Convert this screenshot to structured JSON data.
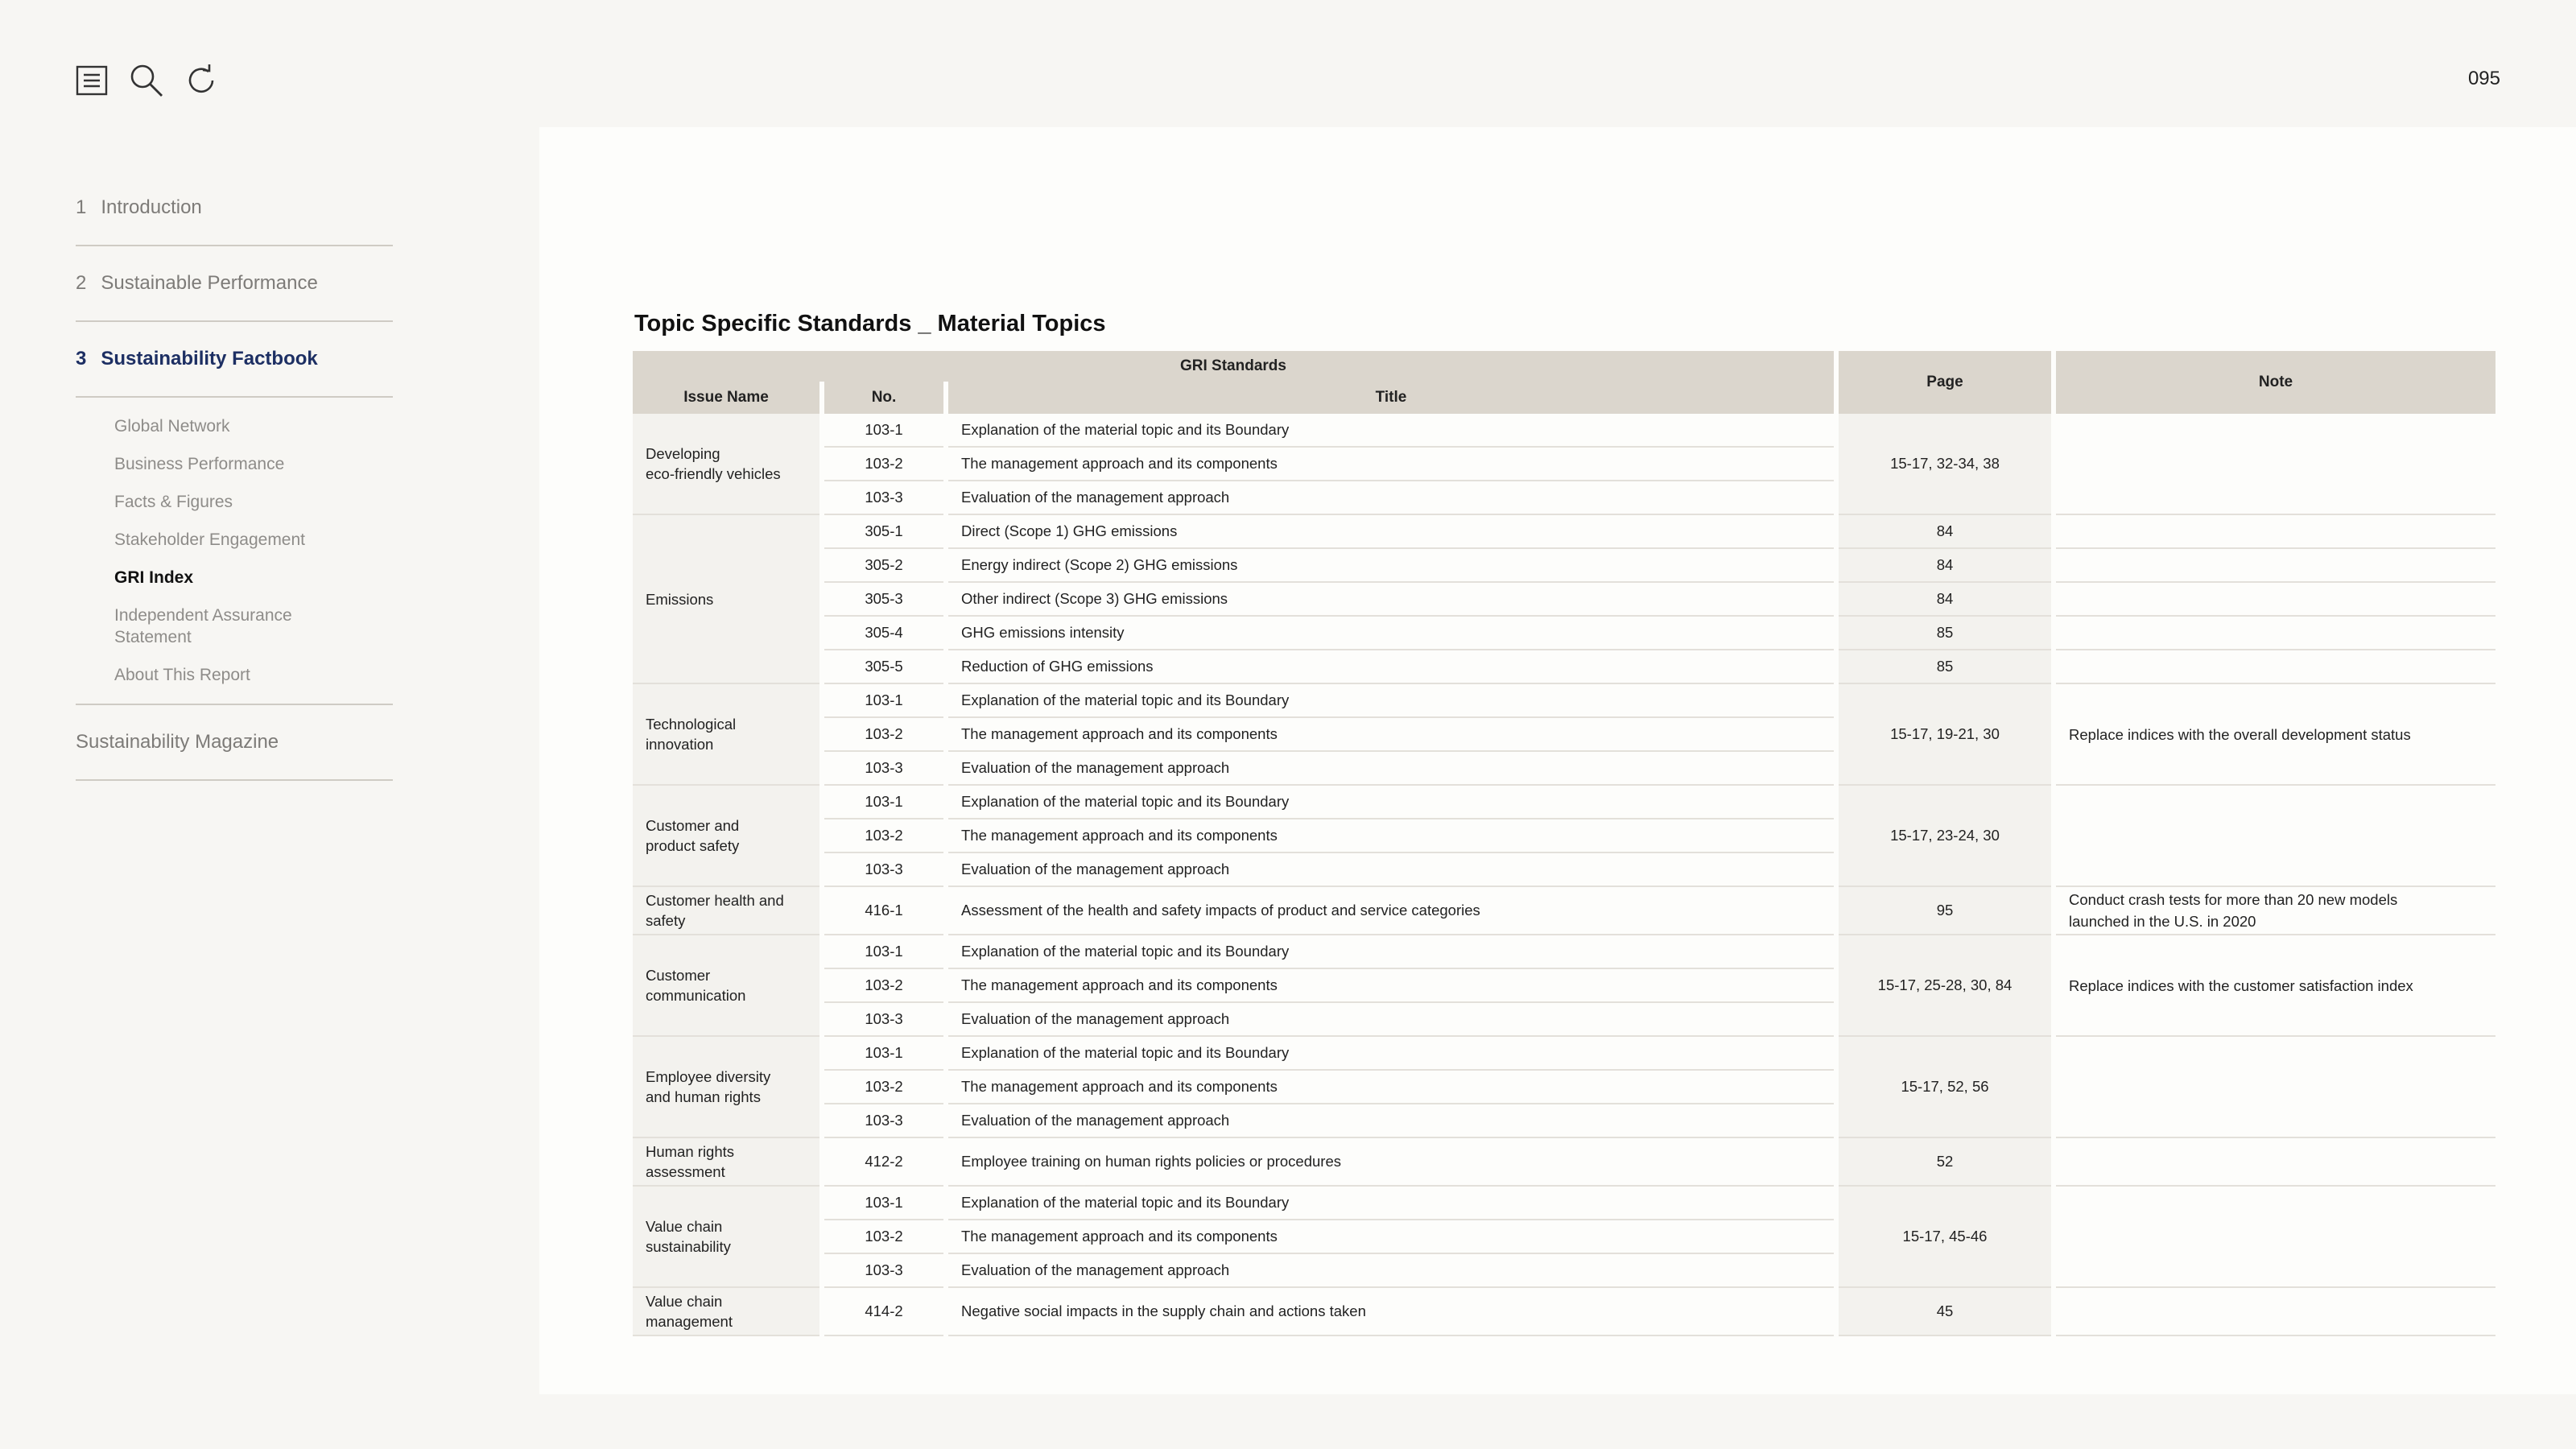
{
  "page_number": "095",
  "toolbar": {
    "icons": [
      "list-icon",
      "search-icon",
      "refresh-icon"
    ]
  },
  "sidebar": {
    "sections": [
      {
        "num": "1",
        "label": "Introduction"
      },
      {
        "num": "2",
        "label": "Sustainable Performance"
      },
      {
        "num": "3",
        "label": "Sustainability Factbook"
      }
    ],
    "subitems": [
      "Global Network",
      "Business Performance",
      "Facts & Figures",
      "Stakeholder Engagement",
      "GRI Index",
      "Independent Assurance Statement",
      "About This Report"
    ],
    "magazine": "Sustainability Magazine"
  },
  "table": {
    "title": "Topic Specific Standards _ Material Topics",
    "headers": {
      "gri_standards": "GRI Standards",
      "issue_name": "Issue Name",
      "no": "No.",
      "title": "Title",
      "page": "Page",
      "note": "Note"
    },
    "groups": [
      {
        "issue": "Developing\neco-friendly vehicles",
        "page": "15-17, 32-34, 38",
        "note": "",
        "rows": [
          {
            "no": "103-1",
            "title": "Explanation of the material topic and its Boundary"
          },
          {
            "no": "103-2",
            "title": "The management approach and its components"
          },
          {
            "no": "103-3",
            "title": "Evaluation of the management approach"
          }
        ]
      },
      {
        "issue": "Emissions",
        "page": "",
        "note": "",
        "rows": [
          {
            "no": "305-1",
            "title": "Direct (Scope 1) GHG emissions",
            "page": "84"
          },
          {
            "no": "305-2",
            "title": "Energy indirect (Scope 2) GHG emissions",
            "page": "84"
          },
          {
            "no": "305-3",
            "title": "Other indirect (Scope 3) GHG emissions",
            "page": "84"
          },
          {
            "no": "305-4",
            "title": "GHG emissions intensity",
            "page": "85"
          },
          {
            "no": "305-5",
            "title": "Reduction of GHG emissions",
            "page": "85"
          }
        ]
      },
      {
        "issue": "Technological\ninnovation",
        "page": "15-17, 19-21, 30",
        "note": "Replace indices with the overall development status",
        "rows": [
          {
            "no": "103-1",
            "title": "Explanation of the material topic and its Boundary"
          },
          {
            "no": "103-2",
            "title": "The management approach and its components"
          },
          {
            "no": "103-3",
            "title": "Evaluation of the management approach"
          }
        ]
      },
      {
        "issue": "Customer and\nproduct safety",
        "page": "15-17, 23-24, 30",
        "note": "",
        "rows": [
          {
            "no": "103-1",
            "title": "Explanation of the material topic and its Boundary"
          },
          {
            "no": "103-2",
            "title": "The management approach and its components"
          },
          {
            "no": "103-3",
            "title": "Evaluation of the management approach"
          }
        ]
      },
      {
        "issue": "Customer health and\nsafety",
        "page": "95",
        "note": "Conduct crash tests for more than 20 new models\nlaunched in the U.S. in 2020",
        "tall": true,
        "rows": [
          {
            "no": "416-1",
            "title": "Assessment of the health and safety impacts of product and service categories"
          }
        ]
      },
      {
        "issue": "Customer\ncommunication",
        "page": "15-17, 25-28, 30, 84",
        "note": "Replace indices with the customer satisfaction index",
        "rows": [
          {
            "no": "103-1",
            "title": "Explanation of the material topic and its Boundary"
          },
          {
            "no": "103-2",
            "title": "The management approach and its components"
          },
          {
            "no": "103-3",
            "title": "Evaluation of the management approach"
          }
        ]
      },
      {
        "issue": "Employee diversity\nand human rights",
        "page": "15-17, 52, 56",
        "note": "",
        "rows": [
          {
            "no": "103-1",
            "title": "Explanation of the material topic and its Boundary"
          },
          {
            "no": "103-2",
            "title": "The management approach and its components"
          },
          {
            "no": "103-3",
            "title": "Evaluation of the management approach"
          }
        ]
      },
      {
        "issue": "Human rights\nassessment",
        "page": "52",
        "note": "",
        "tall": true,
        "rows": [
          {
            "no": "412-2",
            "title": "Employee training on human rights policies or procedures"
          }
        ]
      },
      {
        "issue": "Value chain\nsustainability",
        "page": "15-17, 45-46",
        "note": "",
        "rows": [
          {
            "no": "103-1",
            "title": "Explanation of the material topic and its Boundary"
          },
          {
            "no": "103-2",
            "title": "The management approach and its components"
          },
          {
            "no": "103-3",
            "title": "Evaluation of the management approach"
          }
        ]
      },
      {
        "issue": "Value chain\nmanagement",
        "page": "45",
        "note": "",
        "tall": true,
        "rows": [
          {
            "no": "414-2",
            "title": "Negative social impacts in the supply chain and actions taken"
          }
        ]
      }
    ]
  }
}
